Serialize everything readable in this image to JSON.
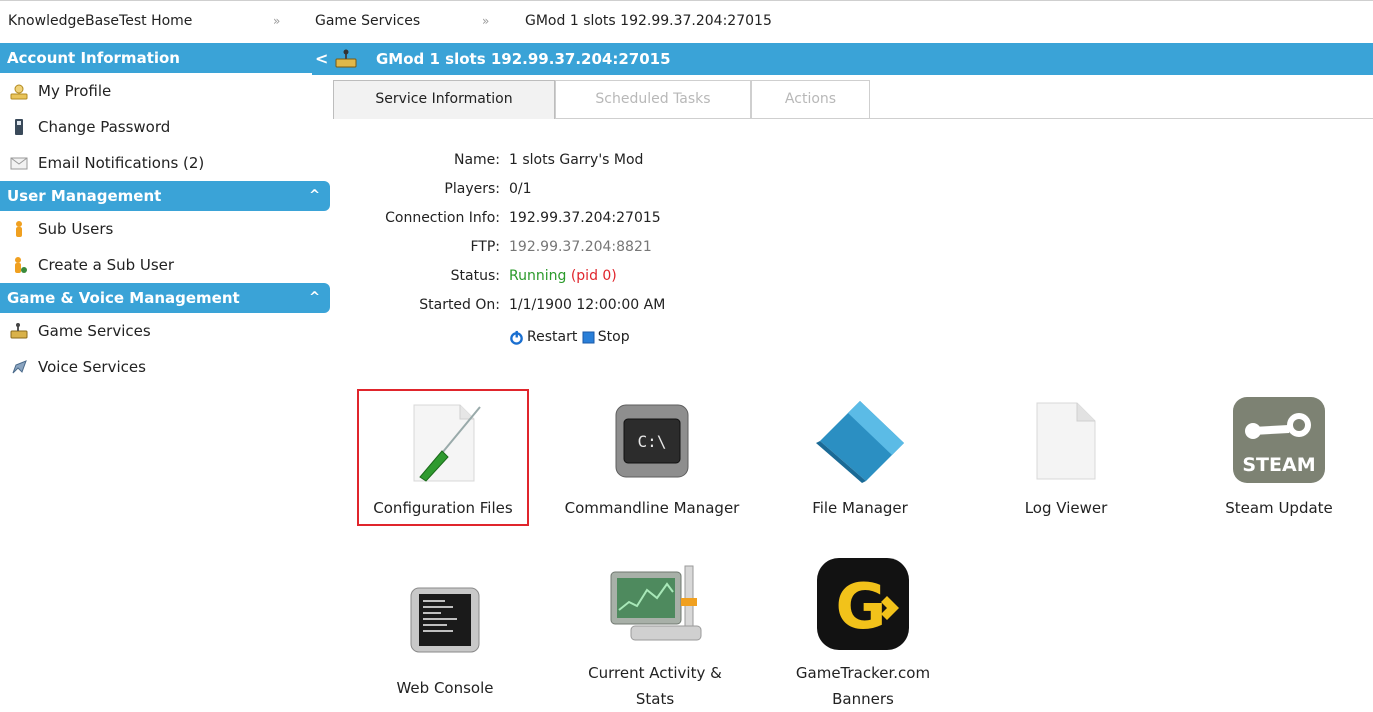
{
  "breadcrumb": {
    "items": [
      "KnowledgeBaseTest Home",
      "Game Services",
      "GMod 1 slots 192.99.37.204:27015"
    ],
    "separator": "»"
  },
  "sidebar": {
    "sections": [
      {
        "title": "Account Information",
        "items": [
          {
            "label": "My Profile",
            "icon": "user-icon"
          },
          {
            "label": "Change Password",
            "icon": "password-icon"
          },
          {
            "label": "Email Notifications (2)",
            "icon": "email-icon"
          }
        ]
      },
      {
        "title": "User Management",
        "toggle": "^",
        "items": [
          {
            "label": "Sub Users",
            "icon": "sub-users-icon"
          },
          {
            "label": "Create a Sub User",
            "icon": "create-user-icon"
          }
        ]
      },
      {
        "title": "Game & Voice Management",
        "toggle": "^",
        "items": [
          {
            "label": "Game Services",
            "icon": "game-services-icon"
          },
          {
            "label": "Voice Services",
            "icon": "voice-services-icon"
          }
        ]
      }
    ]
  },
  "main": {
    "back_glyph": "<",
    "title": "GMod 1 slots 192.99.37.204:27015",
    "tabs": [
      {
        "label": "Service Information",
        "active": true
      },
      {
        "label": "Scheduled Tasks",
        "active": false
      },
      {
        "label": "Actions",
        "active": false
      }
    ],
    "info": {
      "name_label": "Name:",
      "name_value": "1 slots Garry's Mod",
      "players_label": "Players:",
      "players_value": "0/1",
      "connection_label": "Connection Info:",
      "connection_value": "192.99.37.204:27015",
      "ftp_label": "FTP:",
      "ftp_value": "192.99.37.204:8821",
      "status_label": "Status:",
      "status_value": "Running",
      "status_pid": "(pid 0)",
      "started_label": "Started On:",
      "started_value": "1/1/1900 12:00:00 AM"
    },
    "actions": {
      "restart": "Restart",
      "stop": "Stop"
    },
    "tools_row1": [
      {
        "label": "Configuration Files",
        "icon": "config-files-icon",
        "selected": true
      },
      {
        "label": "Commandline Manager",
        "icon": "commandline-icon"
      },
      {
        "label": "File Manager",
        "icon": "file-manager-icon"
      },
      {
        "label": "Log Viewer",
        "icon": "log-viewer-icon"
      },
      {
        "label": "Steam Update",
        "icon": "steam-icon",
        "icon_text": "STEAM"
      }
    ],
    "tools_row2": [
      {
        "label": "Web Console",
        "icon": "web-console-icon"
      },
      {
        "label_line1": "Current Activity &",
        "label_line2": "Stats",
        "icon": "activity-stats-icon"
      },
      {
        "label_line1": "GameTracker.com",
        "label_line2": "Banners",
        "icon": "gametracker-icon",
        "icon_text": "G"
      }
    ],
    "commandline_icon_text": "C:\\"
  },
  "colors": {
    "accent": "#3aa3d7",
    "running": "#2a9a2a",
    "error": "#e0252c"
  }
}
